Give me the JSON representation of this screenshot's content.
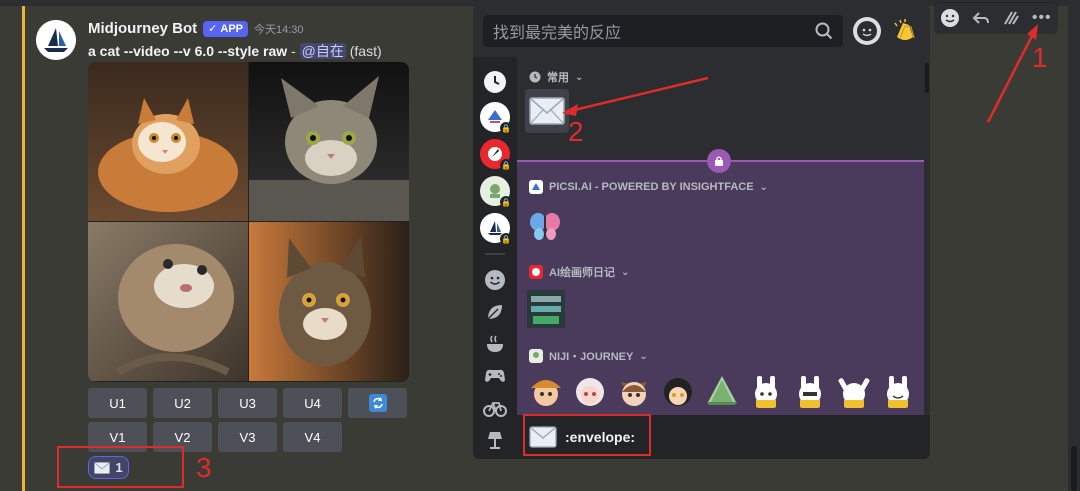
{
  "message": {
    "author": "Midjourney Bot",
    "badge": "APP",
    "timestamp": "今天14:30",
    "prompt": "a cat --video --v 6.0 --style raw",
    "prompt_sep": " - ",
    "mention": "@自在",
    "speed": "(fast)"
  },
  "buttons": {
    "row1": [
      "U1",
      "U2",
      "U3",
      "U4"
    ],
    "row2": [
      "V1",
      "V2",
      "V3",
      "V4"
    ]
  },
  "reaction": {
    "emoji": "envelope-icon",
    "count": "1"
  },
  "annotations": [
    "1",
    "2",
    "3"
  ],
  "picker": {
    "search_placeholder": "找到最完美的反应",
    "sections": [
      {
        "title": "常用"
      },
      {
        "title": "PICSI.AI - POWERED BY INSIGHTFACE"
      },
      {
        "title": "AI绘画师日记"
      },
      {
        "title": "NIJI・JOURNEY"
      }
    ],
    "footer_name": ":envelope:"
  },
  "colors": {
    "accent": "#5865f2",
    "annotation_red": "#e02b2b",
    "mention_bar": "#f0b232",
    "locked_purple": "#9b59b6"
  }
}
